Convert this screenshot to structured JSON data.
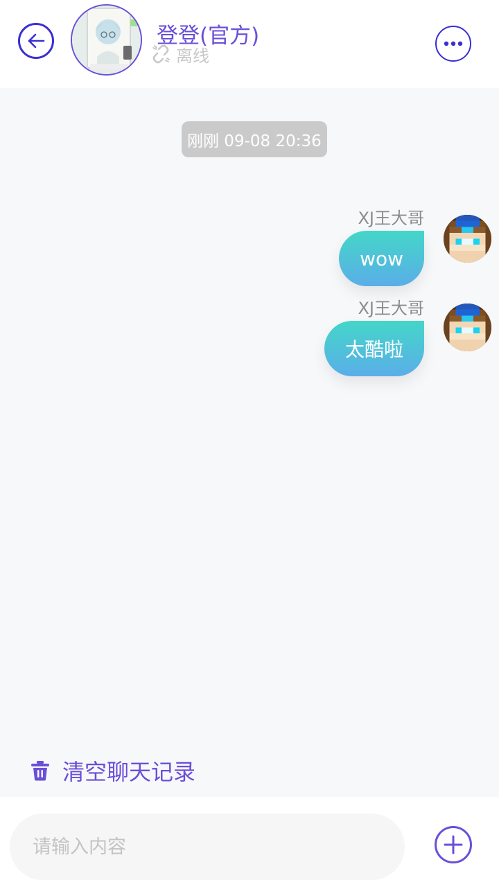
{
  "header": {
    "contact_name": "登登(官方)",
    "status": "离线",
    "back_icon": "back-arrow-icon",
    "more_icon": "more-dots-icon",
    "status_icon": "unlink-icon"
  },
  "chat": {
    "timestamp": "刚刚 09-08 20:36",
    "messages": [
      {
        "sender": "XJ王大哥",
        "text": "wow"
      },
      {
        "sender": "XJ王大哥",
        "text": "太酷啦"
      }
    ],
    "clear_history_label": "清空聊天记录"
  },
  "input": {
    "placeholder": "请输入内容"
  },
  "colors": {
    "accent": "#6a4fd8",
    "icon_blue": "#3a2fd3",
    "bubble_top": "#44d6c8",
    "bubble_bottom": "#5aaee8",
    "chat_bg": "#f7f8fa"
  }
}
